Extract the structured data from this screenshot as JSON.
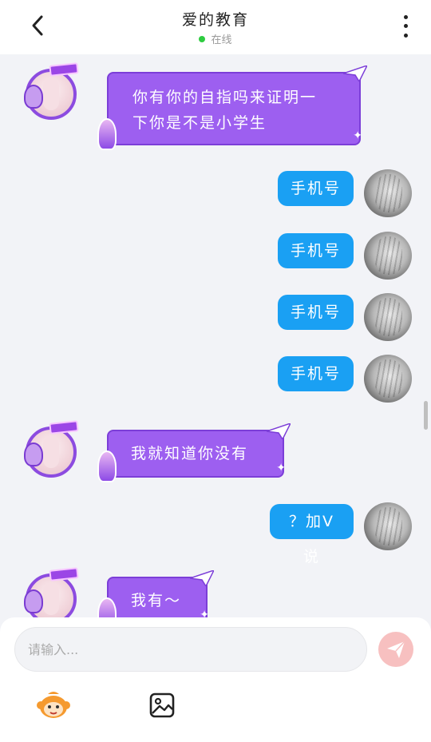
{
  "header": {
    "title": "爱的教育",
    "status": "在线"
  },
  "messages": [
    {
      "side": "left",
      "text_line1": "你有你的自指吗来证明一",
      "text_line2": "下你是不是小学生"
    },
    {
      "side": "right",
      "text": "手机号"
    },
    {
      "side": "right",
      "text": "手机号"
    },
    {
      "side": "right",
      "text": "手机号"
    },
    {
      "side": "right",
      "text": "手机号"
    },
    {
      "side": "left",
      "text": "我就知道你没有"
    },
    {
      "side": "right",
      "text": "？加V说"
    },
    {
      "side": "left",
      "text": "我有～"
    }
  ],
  "composer": {
    "placeholder": "请输入..."
  },
  "icons": {
    "back": "chevron-left-icon",
    "more": "more-vertical-icon",
    "send": "send-icon",
    "emoji": "monkey-emoji-icon",
    "image": "image-icon"
  },
  "colors": {
    "left_bubble": "#9d5ff0",
    "right_bubble": "#1aa0f3",
    "online_dot": "#2ecc40",
    "send_button": "#f7c0c0"
  }
}
